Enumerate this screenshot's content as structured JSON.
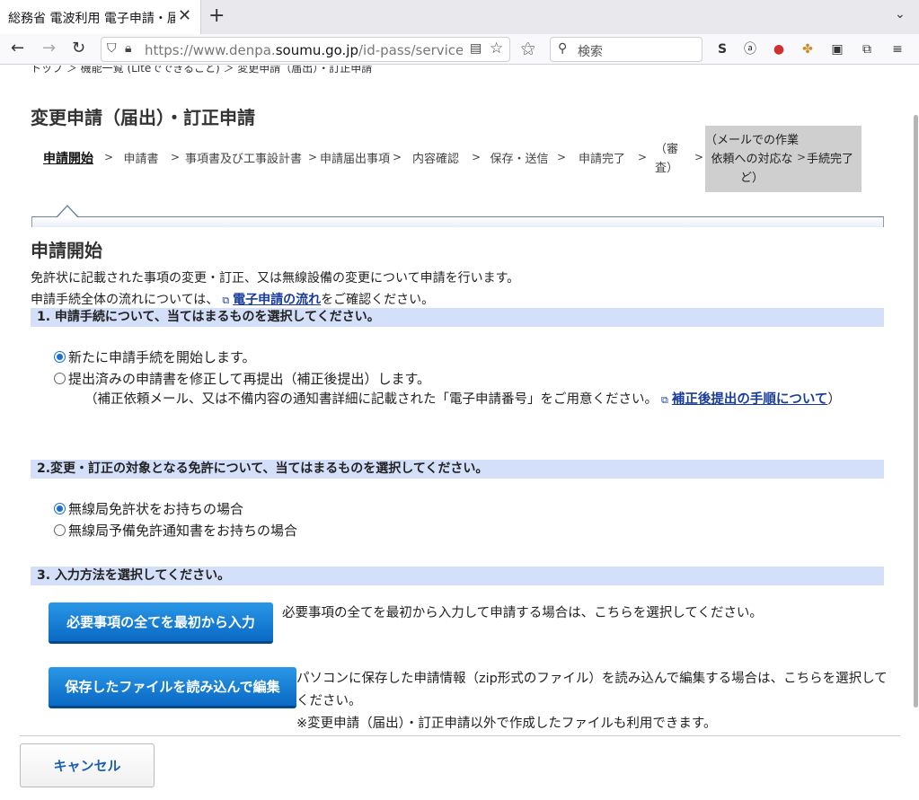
{
  "browser": {
    "tab_title": "総務省 電波利用 電子申請・届出",
    "url_prefix": "https://www.denpa.",
    "url_domain": "soumu.go.jp",
    "url_suffix": "/id-pass/service",
    "search_placeholder": "検索"
  },
  "page": {
    "breadcrumb": "トップ ＞ 機能一覧 (Liteでできること) ＞ 変更申請（届出）・訂正申請",
    "title": "変更申請（届出）・訂正申請",
    "steps": [
      {
        "label": "申請開始"
      },
      {
        "label": "申請書"
      },
      {
        "label": "事項書及び工事設計書"
      },
      {
        "label": "申請届出事項"
      },
      {
        "label": "内容確認"
      },
      {
        "label": "保存・送信"
      },
      {
        "label": "申請完了"
      },
      {
        "label": "（審査）"
      },
      {
        "label": "（メールでの作業依頼への対応など）"
      },
      {
        "label": "手続完了"
      }
    ],
    "step_arrow": ">",
    "section_title": "申請開始",
    "intro_1": "免許状に記載された事項の変更・訂正、又は無線設備の変更について申請を行います。",
    "intro_2_before": "申請手続全体の流れについては、",
    "intro_2_link": "電子申請の流れ",
    "intro_2_after": "をご確認ください。",
    "q1": {
      "heading": "1. 申請手続について、当てはまるものを選択してください。",
      "option_1": "新たに申請手続を開始します。",
      "option_2": "提出済みの申請書を修正して再提出（補正後提出）します。",
      "note_before": "（補正依頼メール、又は不備内容の通知書詳細に記載された「電子申請番号」をご用意ください。",
      "note_link": "補正後提出の手順について",
      "note_after": "）"
    },
    "q2": {
      "heading": "2.変更・訂正の対象となる免許について、当てはまるものを選択してください。",
      "option_1": "無線局免許状をお持ちの場合",
      "option_2": "無線局予備免許通知書をお持ちの場合"
    },
    "q3": {
      "heading": "3. 入力方法を選択してください。",
      "button_1": "必要事項の全てを最初から入力",
      "button_1_desc": "必要事項の全てを最初から入力して申請する場合は、こちらを選択してください。",
      "button_2": "保存したファイルを読み込んで編集",
      "button_2_desc": "パソコンに保存した申請情報（zip形式のファイル）を読み込んで編集する場合は、こちらを選択してください。",
      "button_2_note": "※変更申請（届出）・訂正申請以外で作成したファイルも利用できます。"
    },
    "cancel_label": "キャンセル"
  }
}
